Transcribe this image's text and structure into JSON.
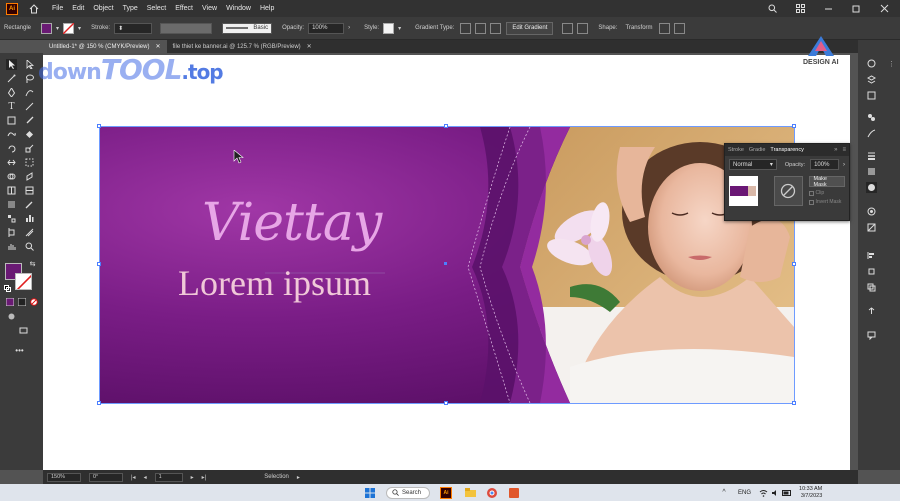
{
  "app": {
    "logo_text": "Ai",
    "menu": [
      "File",
      "Edit",
      "Object",
      "Type",
      "Select",
      "Effect",
      "View",
      "Window",
      "Help"
    ]
  },
  "control_bar": {
    "object_type": "Rectangle",
    "stroke_label": "Stroke:",
    "stroke_profile": "Basic",
    "opacity_label": "Opacity:",
    "opacity_value": "100%",
    "style_label": "Style:",
    "gradient_type_label": "Gradient Type:",
    "edit_gradient": "Edit Gradient",
    "shape_label": "Shape:",
    "transform_label": "Transform",
    "fill_color": "#6a1a74"
  },
  "tabs": [
    {
      "label": "Untitled-1* @ 150 % (CMYK/Preview)"
    },
    {
      "label": "file thiet ke banner.ai @ 125.7 % (RGB/Preview)"
    }
  ],
  "watermark": {
    "part1": "down",
    "part2": "TOOL",
    "part3": ".top",
    "brand": "DESIGN AI"
  },
  "banner": {
    "title": "Viettay",
    "subtitle": "Lorem ipsum",
    "bg_color": "#6a1775",
    "accent": "#8a2b96"
  },
  "transparency_panel": {
    "tabs": [
      "Stroke",
      "Gradie",
      "Transparency"
    ],
    "blend_mode": "Normal",
    "opacity_label": "Opacity:",
    "opacity_value": "100%",
    "make_mask": "Make Mask",
    "clip_label": "Clip",
    "invert_label": "Invert Mask"
  },
  "status_bar": {
    "zoom": "150%",
    "rotation": "0°",
    "artboard": "1",
    "tool": "Selection"
  },
  "taskbar": {
    "search_label": "Search",
    "lang": "ENG",
    "time": "10:33 AM",
    "date": "3/7/2023"
  }
}
